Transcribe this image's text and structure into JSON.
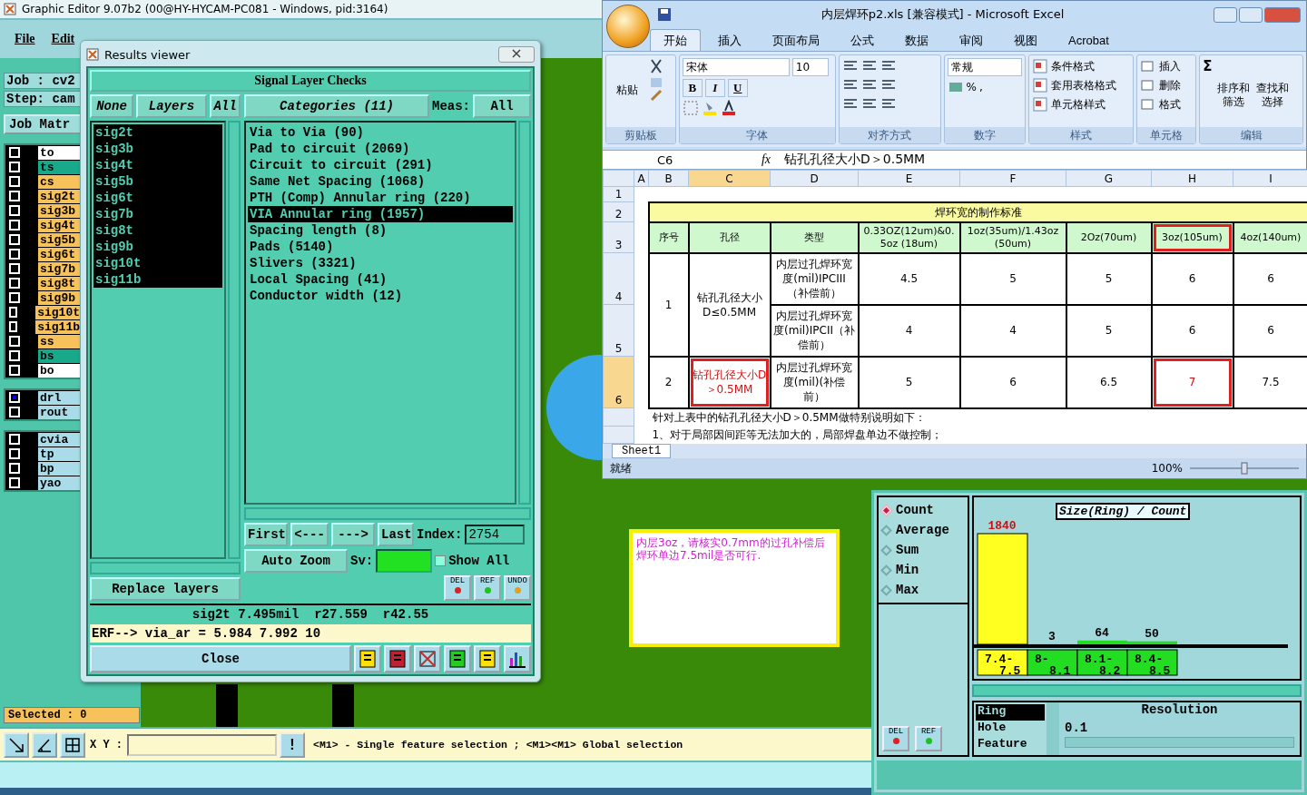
{
  "app": {
    "title": "Graphic Editor 9.07b2 (00@HY-HYCAM-PC081 - Windows, pid:3164)",
    "menu": [
      "File",
      "Edit"
    ],
    "job": "Job : cv2",
    "step": "Step: cam",
    "matrix_button": "Job Matr",
    "layer_groups": [
      [
        {
          "name": "to",
          "color": "#ffffff",
          "checked": false
        },
        {
          "name": "ts",
          "color": "#17a98a",
          "checked": false
        },
        {
          "name": "cs",
          "color": "#f8c25a",
          "checked": false
        },
        {
          "name": "sig2t",
          "color": "#f8c25a",
          "checked": false
        },
        {
          "name": "sig3b",
          "color": "#f8c25a",
          "checked": false
        },
        {
          "name": "sig4t",
          "color": "#f8c25a",
          "checked": false
        },
        {
          "name": "sig5b",
          "color": "#f8c25a",
          "checked": false
        },
        {
          "name": "sig6t",
          "color": "#f8c25a",
          "checked": false
        },
        {
          "name": "sig7b",
          "color": "#f8c25a",
          "checked": false
        },
        {
          "name": "sig8t",
          "color": "#f8c25a",
          "checked": false
        },
        {
          "name": "sig9b",
          "color": "#f8c25a",
          "checked": false
        },
        {
          "name": "sig10t",
          "color": "#f8c25a",
          "checked": false
        },
        {
          "name": "sig11b",
          "color": "#f8c25a",
          "checked": false
        },
        {
          "name": "ss",
          "color": "#f8c25a",
          "checked": false
        },
        {
          "name": "bs",
          "color": "#17a98a",
          "checked": false
        },
        {
          "name": "bo",
          "color": "#ffffff",
          "checked": false
        }
      ],
      [
        {
          "name": "drl",
          "color": "#a9dce8",
          "checked": true
        },
        {
          "name": "rout",
          "color": "#a9dce8",
          "checked": false
        }
      ],
      [
        {
          "name": "cvia",
          "color": "#a9dce8",
          "checked": false
        },
        {
          "name": "tp",
          "color": "#a9dce8",
          "checked": false
        },
        {
          "name": "bp",
          "color": "#a9dce8",
          "checked": false
        },
        {
          "name": "yao",
          "color": "#a9dce8",
          "checked": false
        }
      ]
    ],
    "selected_count": "Selected : 0",
    "xy_label": "X Y :",
    "alert": "!",
    "message": "<M1> - Single feature selection ; <M1><M1> Global selection"
  },
  "results": {
    "title": "Results viewer",
    "header": "Signal Layer Checks",
    "none": "None",
    "layers_label": "Layers",
    "all": "All",
    "categories_label": "Categories (11)",
    "meas_label": "Meas:",
    "meas_value": "All",
    "layers": [
      {
        "name": "sig2t",
        "selected": true
      },
      {
        "name": "sig3b",
        "selected": true
      },
      {
        "name": "sig4t",
        "selected": true
      },
      {
        "name": "sig5b",
        "selected": true
      },
      {
        "name": "sig6t",
        "selected": true
      },
      {
        "name": "sig7b",
        "selected": true
      },
      {
        "name": "sig8t",
        "selected": true
      },
      {
        "name": "sig9b",
        "selected": true
      },
      {
        "name": "sig10t",
        "selected": true
      },
      {
        "name": "sig11b",
        "selected": true
      }
    ],
    "categories": [
      {
        "name": "Via to Via (90)",
        "selected": false
      },
      {
        "name": "Pad to circuit (2069)",
        "selected": false
      },
      {
        "name": "Circuit to circuit (291)",
        "selected": false
      },
      {
        "name": "Same Net Spacing (1068)",
        "selected": false
      },
      {
        "name": "PTH (Comp) Annular ring (220)",
        "selected": false
      },
      {
        "name": "VIA Annular ring (1957)",
        "selected": true
      },
      {
        "name": "Spacing length (8)",
        "selected": false
      },
      {
        "name": "Pads (5140)",
        "selected": false
      },
      {
        "name": "Slivers (3321)",
        "selected": false
      },
      {
        "name": "Local Spacing (41)",
        "selected": false
      },
      {
        "name": "Conductor width (12)",
        "selected": false
      }
    ],
    "nav": [
      "First",
      "<---",
      "--->",
      "Last"
    ],
    "index_label": "Index:",
    "index_value": "2754",
    "auto_zoom": "Auto Zoom",
    "sv_label": "Sv:",
    "show_all": {
      "label": "Show All",
      "checked": false
    },
    "replace": "Replace layers",
    "small_buttons": [
      "DEL",
      "REF",
      "UNDO"
    ],
    "info": "sig2t 7.495mil  r27.559  r42.55",
    "erf": "ERF--> via_ar = 5.984 7.992 10",
    "close": "Close"
  },
  "note": {
    "text": "内层3oz，请核实0.7mm的过孔补偿后焊环单边7.5mil是否可行."
  },
  "excel": {
    "title": "内层焊环p2.xls  [兼容模式] - Microsoft Excel",
    "tabs": [
      {
        "label": "开始",
        "selected": true
      },
      {
        "label": "插入",
        "selected": false
      },
      {
        "label": "页面布局",
        "selected": false
      },
      {
        "label": "公式",
        "selected": false
      },
      {
        "label": "数据",
        "selected": false
      },
      {
        "label": "审阅",
        "selected": false
      },
      {
        "label": "视图",
        "selected": false
      },
      {
        "label": "Acrobat",
        "selected": false
      }
    ],
    "paste": "粘贴",
    "font_name": "宋体",
    "font_size": "10",
    "font_buttons": [
      "B",
      "I",
      "U"
    ],
    "number_format": "常规",
    "percent": "%",
    "comma": ",",
    "style_items": [
      "条件格式",
      "套用表格格式",
      "单元格样式"
    ],
    "cell_items": [
      "插入",
      "删除",
      "格式"
    ],
    "sigma": "Σ",
    "edit_items": [
      "排序和筛选",
      "查找和选择"
    ],
    "groups": [
      "剪贴板",
      "字体",
      "对齐方式",
      "数字",
      "样式",
      "单元格",
      "编辑"
    ],
    "name_box": "C6",
    "fx": "fx",
    "formula": "钻孔孔径大小D＞0.5MM",
    "columns": [
      {
        "label": "A",
        "selected": false
      },
      {
        "label": "B",
        "selected": false
      },
      {
        "label": "C",
        "selected": true
      },
      {
        "label": "D",
        "selected": false
      },
      {
        "label": "E",
        "selected": false
      },
      {
        "label": "F",
        "selected": false
      },
      {
        "label": "G",
        "selected": false
      },
      {
        "label": "H",
        "selected": false
      },
      {
        "label": "I",
        "selected": false
      }
    ],
    "row_numbers": [
      {
        "label": "1",
        "selected": false
      },
      {
        "label": "2",
        "selected": false
      },
      {
        "label": "3",
        "selected": false
      },
      {
        "label": "4",
        "selected": false
      },
      {
        "label": "5",
        "selected": false
      },
      {
        "label": "6",
        "selected": true
      }
    ],
    "table_title": "焊环宽的制作标准",
    "headers": [
      {
        "text": "序号",
        "highlighted": false
      },
      {
        "text": "孔径",
        "highlighted": false
      },
      {
        "text": "类型",
        "highlighted": false
      },
      {
        "text": "0.33OZ(12um)&0.5oz (18um)",
        "highlighted": false
      },
      {
        "text": "1oz(35um)/1.43oz (50um)",
        "highlighted": false
      },
      {
        "text": "2Oz(70um)",
        "highlighted": false
      },
      {
        "text": "3oz(105um)",
        "highlighted": true
      },
      {
        "text": "4oz(140um)",
        "highlighted": false
      }
    ],
    "groups_rows": [
      {
        "no": "1",
        "hole": {
          "text": "钻孔孔径大小D≤0.5MM",
          "highlighted": false
        },
        "rows": [
          {
            "type": "内层过孔焊环宽度(mil)IPCIII（补偿前）",
            "values": [
              {
                "text": "4.5",
                "highlighted": false
              },
              {
                "text": "5",
                "highlighted": false
              },
              {
                "text": "5",
                "highlighted": false
              },
              {
                "text": "6",
                "highlighted": false
              },
              {
                "text": "6",
                "highlighted": false
              }
            ]
          },
          {
            "type": "内层过孔焊环宽度(mil)IPCII（补偿前）",
            "values": [
              {
                "text": "4",
                "highlighted": false
              },
              {
                "text": "4",
                "highlighted": false
              },
              {
                "text": "5",
                "highlighted": false
              },
              {
                "text": "6",
                "highlighted": false
              },
              {
                "text": "6",
                "highlighted": false
              }
            ]
          }
        ]
      },
      {
        "no": "2",
        "hole": {
          "text": "钻孔孔径大小D＞0.5MM",
          "highlighted": true
        },
        "rows": [
          {
            "type": "内层过孔焊环宽度(mil)(补偿前）",
            "values": [
              {
                "text": "5",
                "highlighted": false
              },
              {
                "text": "6",
                "highlighted": false
              },
              {
                "text": "6.5",
                "highlighted": false
              },
              {
                "text": "7",
                "highlighted": true
              },
              {
                "text": "7.5",
                "highlighted": false
              }
            ]
          }
        ]
      }
    ],
    "notes": [
      "针对上表中的钻孔孔径大小D＞0.5MM做特别说明如下：",
      "1、对于局部因间距等无法加大的，局部焊盘单边不做控制；"
    ],
    "sheet": "Sheet1",
    "status": "就绪",
    "zoom": "100%",
    "zoom_slider": {
      "level": 0.5
    }
  },
  "histogram": {
    "modes": [
      {
        "label": "Count",
        "selected": true
      },
      {
        "label": "Average",
        "selected": false
      },
      {
        "label": "Sum",
        "selected": false
      },
      {
        "label": "Min",
        "selected": false
      },
      {
        "label": "Max",
        "selected": false
      }
    ],
    "chart_data": {
      "type": "bar",
      "title": "Size(Ring) / Count",
      "categories": [
        "7.4-\n7.5",
        "8-\n8.1",
        "8.1-\n8.2",
        "8.4-\n8.5"
      ],
      "series": [
        {
          "color": "#ffff20",
          "values": [
            1840,
            null,
            null,
            null
          ]
        },
        {
          "color": "#22dd22",
          "values": [
            null,
            3,
            64,
            50
          ]
        }
      ],
      "data_labels": true
    },
    "fields": [
      {
        "label": "Ring",
        "selected": true
      },
      {
        "label": "Hole",
        "selected": false
      },
      {
        "label": "Feature",
        "selected": false
      }
    ],
    "resolution_label": "Resolution",
    "resolution_value": "0.1",
    "buttons": [
      "DEL",
      "REF"
    ]
  }
}
